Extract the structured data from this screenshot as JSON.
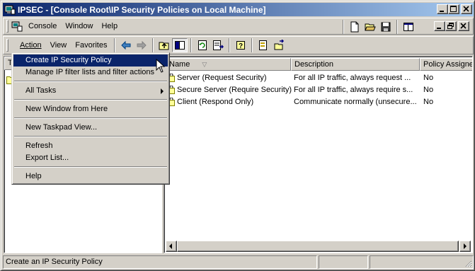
{
  "window": {
    "title": "IPSEC - [Console Root\\IP Security Policies on Local Machine]",
    "icon": "mmc-console-icon"
  },
  "menubar": {
    "items": [
      {
        "label": "Console",
        "underline": "C"
      },
      {
        "label": "Window",
        "underline": "W"
      },
      {
        "label": "Help",
        "underline": "H"
      }
    ]
  },
  "action_bar": {
    "items": [
      {
        "label": "Action",
        "underline": "A"
      },
      {
        "label": "View",
        "underline": "V"
      },
      {
        "label": "Favorites",
        "underline": "F"
      }
    ]
  },
  "left_pane": {
    "header_fragment": "T"
  },
  "list": {
    "columns": [
      "Name",
      "Description",
      "Policy Assigned"
    ],
    "sort_indicator": "▽",
    "rows": [
      {
        "name": "Server (Request Security)",
        "description": "For all IP traffic, always request ...",
        "assigned": "No"
      },
      {
        "name": "Secure Server (Require Security)",
        "description": "For all IP traffic, always require s...",
        "assigned": "No"
      },
      {
        "name": "Client (Respond Only)",
        "description": "Communicate normally (unsecure...",
        "assigned": "No"
      }
    ]
  },
  "context_menu": {
    "items": [
      {
        "label": "Create IP Security Policy",
        "highlighted": true
      },
      {
        "label": "Manage IP filter lists and filter actions"
      },
      {
        "separator": true
      },
      {
        "label": "All Tasks",
        "submenu": true
      },
      {
        "separator": true
      },
      {
        "label": "New Window from Here"
      },
      {
        "separator": true
      },
      {
        "label": "New Taskpad View..."
      },
      {
        "separator": true
      },
      {
        "label": "Refresh"
      },
      {
        "label": "Export List..."
      },
      {
        "separator": true
      },
      {
        "label": "Help"
      }
    ]
  },
  "statusbar": {
    "text": "Create an IP Security Policy"
  },
  "colors": {
    "titlebar_start": "#0a246a",
    "titlebar_end": "#a6caf0",
    "highlight": "#0a246a",
    "face": "#d4d0c8"
  }
}
